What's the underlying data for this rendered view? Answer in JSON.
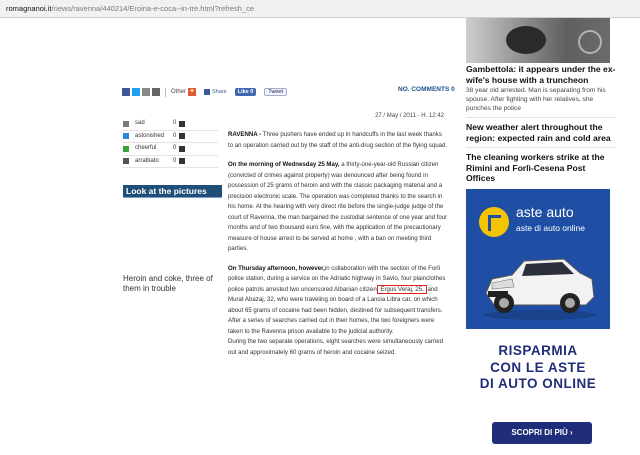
{
  "browser": {
    "url_host": "romagnanoi.it",
    "url_path": "/news/ravenna/440214/Eroina-e-coca--in-tre.html?refresh_ce"
  },
  "share": {
    "other_label": "Other",
    "share_label": "Share",
    "like_label": "Like 0",
    "tweet_label": "Tweet",
    "comments_label": "NO. COMMENTS 0"
  },
  "dateline": "27 / May / 2011 - H. 12:42",
  "reactions": [
    {
      "label": "sad",
      "count": "0",
      "color": "#7a7a7a"
    },
    {
      "label": "astonished",
      "count": "0",
      "color": "#2f86d6"
    },
    {
      "label": "cheerful",
      "count": "0",
      "color": "#3aa33a"
    },
    {
      "label": "arrabiato",
      "count": "0",
      "color": "#555555"
    }
  ],
  "look_label": "Look at the pictures",
  "related_title": "Heroin and coke, three of them in trouble",
  "article": {
    "p1_lead": "RAVENNA -",
    "p1_text": " Three pushers have ended up in handcuffs in the last week thanks to an operation carried out by the staff of the anti-drug section of the flying squad.",
    "p2_lead": "On the morning of Wednesday 25 May,",
    "p2_text": " a thirty-one-year-old Russian citizen (convicted of crimes against property) was denounced after being found in possession of 25 grams of heroin and with the classic packaging material and a precision electronic scale. The operation was completed thanks to the search in his home. At the hearing with very direct rite before the single-judge judge of the court of Ravenna, the man bargained the custodial sentence of one year and four months and of two thousand euro fine, with the application of the precautionary measure of house arrest to be served at home , with a ban on meeting third parties.",
    "p3_lead": "On Thursday afternoon, however,",
    "p3_text_a": "in collaboration with the section of the Forlì police station, during a service on the Adriatic highway in Savio, four plainclothes police patrols arrested two uncensored Albanian citizen",
    "p3_highlight": " Ergus Veraj, 25, ",
    "p3_text_b": "and Murat Abazaj, 32, who were traveling on board of a Lancia Libra car, on which about 65 grams of cocaine had been hidden, destined for subsequent transfers. After a series of searches carried out in their homes, the two foreigners were taken to the Ravenna prison available to the judicial authority.",
    "p4_text": "During the two separate operations, eight searches were simultaneously carried out and approximately 60 grams of heroin and cocaine seized."
  },
  "sidebar": {
    "item1_title": "Gambettola: it appears under the ex-wife's house with a truncheon",
    "item1_text": "38 year old arrested. Man is separating from his spouse. After fighting with her relatives, she punches the police",
    "item2_title": "New weather alert throughout the region: expected rain and cold area",
    "item3_title": "The cleaning workers strike at the Rimini and Forlì-Cesena Post Offices"
  },
  "ad": {
    "brand": "aste auto",
    "sub": "aste di auto online",
    "headline_1": "RISPARMIA",
    "headline_2": "CON LE ASTE",
    "headline_3": "DI AUTO ONLINE",
    "button": "SCOPRI DI PIÙ ›"
  }
}
